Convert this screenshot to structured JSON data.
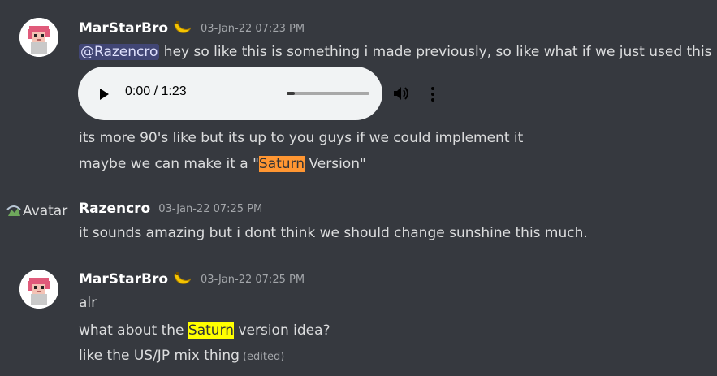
{
  "messages": [
    {
      "username": "MarStarBro",
      "timestamp": "03-Jan-22 07:23 PM",
      "mention": "@Razencro",
      "line1_text": " hey so like this is something i made previously, so like what if we just used this",
      "audio": {
        "time": "0:00 / 1:23",
        "progress": 0.1
      },
      "line2_text": "its more 90's like but its up to you guys if we could implement it",
      "line3_pre": "maybe we can make it a \"",
      "line3_highlight": "Saturn",
      "line3_post": " Version\""
    },
    {
      "avatar_alt": "Avatar",
      "username": "Razencro",
      "timestamp": "03-Jan-22 07:25 PM",
      "line1_text": "it sounds amazing but i dont think we should change sunshine this much."
    },
    {
      "username": "MarStarBro",
      "timestamp": "03-Jan-22 07:25 PM",
      "line1_text": "alr",
      "line2_pre": "what about the ",
      "line2_highlight": "Saturn",
      "line2_post": " version idea?",
      "line3_text": "like the US/JP mix thing",
      "edited_label": "(edited)"
    }
  ],
  "colors": {
    "background": "#36393f",
    "mention_bg": "#414675",
    "highlight_orange": "#ff9632",
    "highlight_yellow": "#ffff00"
  }
}
